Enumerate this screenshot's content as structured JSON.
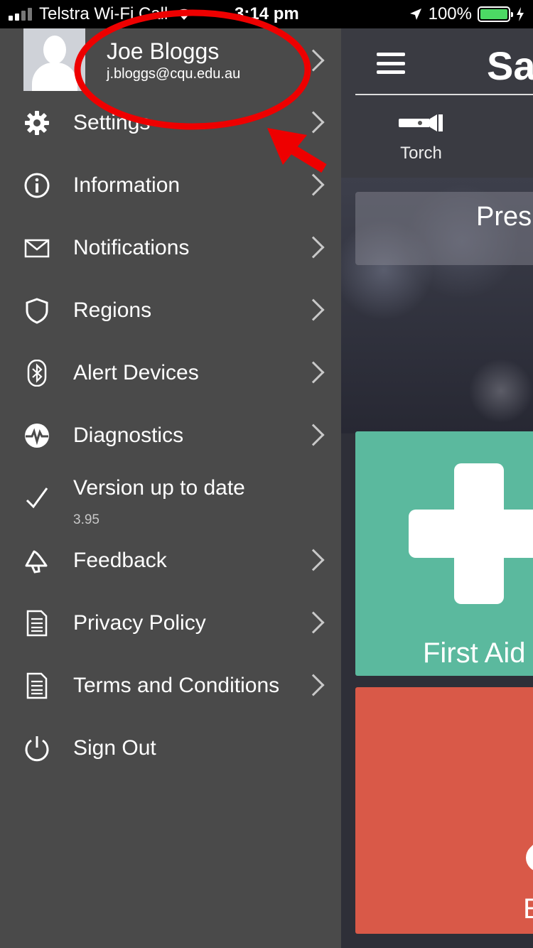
{
  "status_bar": {
    "carrier": "Telstra Wi-Fi Call",
    "time": "3:14 pm",
    "battery": "100%",
    "battery_level": 1.0,
    "battery_color": "#4cd964"
  },
  "side_menu": {
    "profile": {
      "name": "Joe Bloggs",
      "email": "j.bloggs@cqu.edu.au"
    },
    "items": [
      {
        "label": "Settings",
        "icon": "gear-icon",
        "chevron": true
      },
      {
        "label": "Information",
        "icon": "info-icon",
        "chevron": true
      },
      {
        "label": "Notifications",
        "icon": "envelope-icon",
        "chevron": true
      },
      {
        "label": "Regions",
        "icon": "shield-icon",
        "chevron": true
      },
      {
        "label": "Alert Devices",
        "icon": "bluetooth-icon",
        "chevron": true
      },
      {
        "label": "Diagnostics",
        "icon": "pulse-icon",
        "chevron": true
      },
      {
        "label": "Version up to date",
        "sublabel": "3.95",
        "icon": "checkmark-icon",
        "chevron": false
      },
      {
        "label": "Feedback",
        "icon": "megaphone-icon",
        "chevron": true
      },
      {
        "label": "Privacy Policy",
        "icon": "document-icon",
        "chevron": true
      },
      {
        "label": "Terms and Conditions",
        "icon": "document-icon",
        "chevron": true
      },
      {
        "label": "Sign Out",
        "icon": "power-icon",
        "chevron": false
      }
    ]
  },
  "main_app": {
    "title": "Sa",
    "torch_label": "Torch",
    "press_text": "Pres",
    "first_aid_label": "First Aid",
    "emergency_label": "E",
    "colors": {
      "first_aid": "#5bb99e",
      "emergency": "#d95948"
    }
  },
  "annotation": {
    "color": "#ee0000"
  }
}
